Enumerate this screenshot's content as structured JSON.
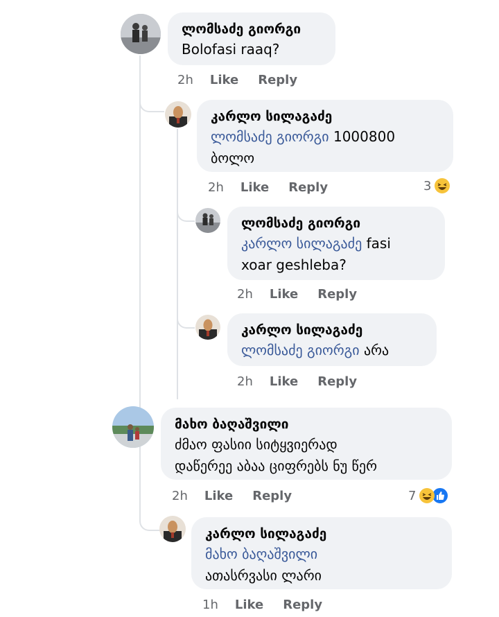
{
  "comments": [
    {
      "author": "ლომსაძე გიორგი",
      "text": "Bolofasi raaq?",
      "time": "2h",
      "like": "Like",
      "reply": "Reply"
    },
    {
      "author": "კარლო სილაგაძე",
      "mention": "ლომსაძე გიორგი",
      "text_line1": " 1000800",
      "text_line2": "ბოლო",
      "time": "2h",
      "like": "Like",
      "reply": "Reply",
      "reactions": "3",
      "reaction_icon": "haha-emoji"
    },
    {
      "author": "ლომსაძე გიორგი",
      "mention": "კარლო სილაგაძე",
      "text_line1": " fasi",
      "text_line2": "xoar geshleba?",
      "time": "2h",
      "like": "Like",
      "reply": "Reply"
    },
    {
      "author": "კარლო სილაგაძე",
      "mention": "ლომსაძე გიორგი",
      "text_line1": " არა",
      "time": "2h",
      "like": "Like",
      "reply": "Reply"
    },
    {
      "author": "მახო ბაღაშვილი",
      "text_line1": "ძმაო ფასიი სიტყვიერად",
      "text_line2": "დაწერეე აბაა ციფრებს ნუ წერ",
      "time": "2h",
      "like": "Like",
      "reply": "Reply",
      "reactions": "7",
      "reaction_icons": [
        "haha-emoji",
        "like-icon"
      ]
    },
    {
      "author": "კარლო სილაგაძე",
      "mention": "მახო ბაღაშვილი",
      "text_line2": "ათასრვასი ლარი",
      "time": "1h",
      "like": "Like",
      "reply": "Reply"
    }
  ],
  "colors": {
    "bubble": "#f0f2f5",
    "mention": "#385898",
    "meta": "#65676b",
    "thread_line": "#dfe2e6",
    "like_blue": "#1877f2",
    "haha_yellow": "#f7c33a"
  }
}
